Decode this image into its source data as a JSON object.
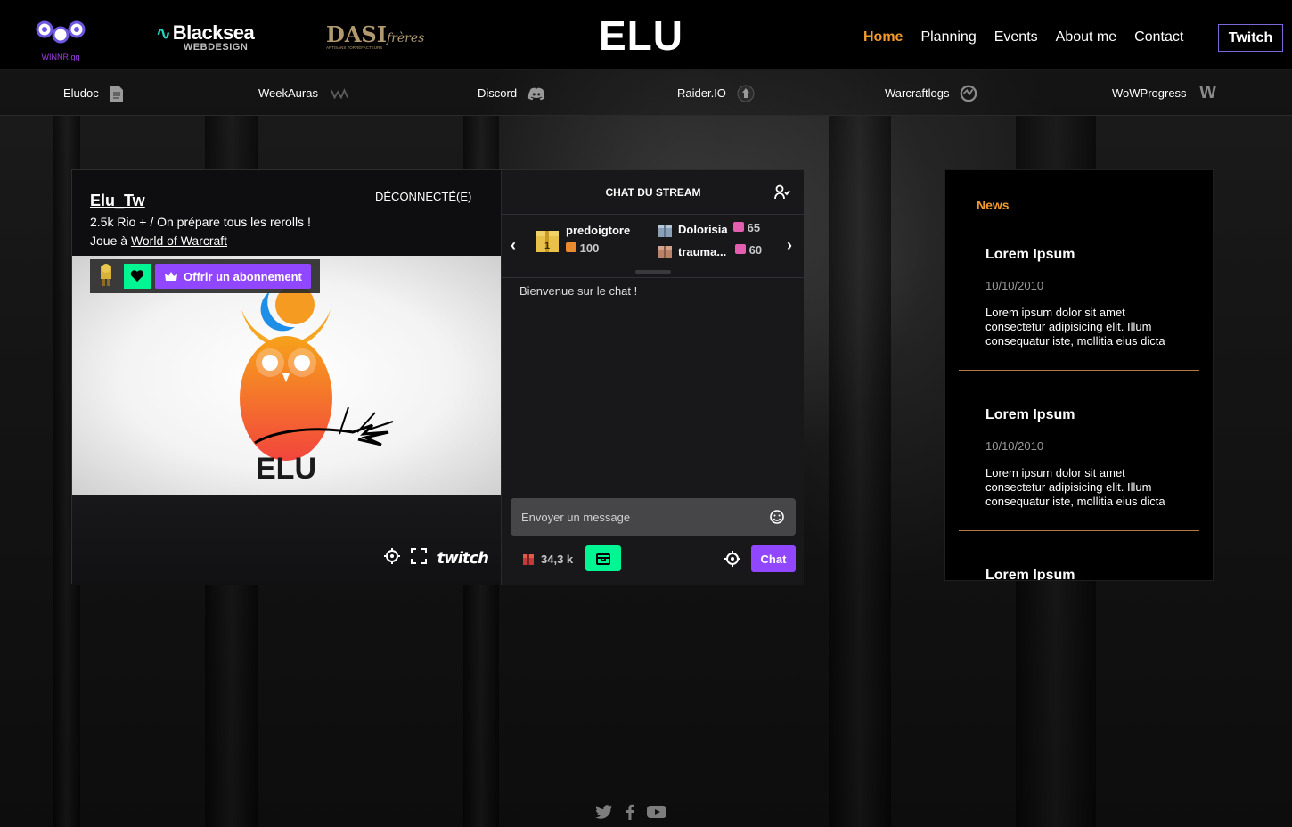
{
  "header": {
    "site_title": "ELU",
    "logos": {
      "winnr": "WINNR.gg",
      "blacksea_title": "Blacksea",
      "blacksea_sub": "WEBDESIGN",
      "dasi_title": "DASI",
      "dasi_script": "frères",
      "dasi_sub": "ARTISANS TORRÉFACTEURS"
    },
    "nav": [
      "Home",
      "Planning",
      "Events",
      "About me",
      "Contact"
    ],
    "nav_active": "Home",
    "twitch_button": "Twitch"
  },
  "subnav": [
    {
      "label": "Eludoc",
      "icon": "document-icon"
    },
    {
      "label": "WeekAuras",
      "icon": "weakauras-icon"
    },
    {
      "label": "Discord",
      "icon": "discord-icon"
    },
    {
      "label": "Raider.IO",
      "icon": "raiderio-icon"
    },
    {
      "label": "Warcraftlogs",
      "icon": "warcraftlogs-icon"
    },
    {
      "label": "WoWProgress",
      "icon": "wowprogress-icon"
    }
  ],
  "player": {
    "channel_name": "Elu_Tw",
    "stream_title": "2.5k Rio + / On prépare tous les rerolls !",
    "game_prefix": "Joue à",
    "game_name": "World of Warcraft",
    "status": "DÉCONNECTÉ(E)",
    "subscribe_label": "Offrir un abonnement",
    "watermark": "ELU",
    "brand": "twitch"
  },
  "chat": {
    "title": "CHAT DU STREAM",
    "leaderboard": [
      {
        "name": "predoigtore",
        "value": "100",
        "rank": "1"
      },
      {
        "name": "Dolorisia",
        "value": "65"
      },
      {
        "name": "trauma...",
        "value": "60"
      }
    ],
    "welcome": "Bienvenue sur le chat !",
    "input_placeholder": "Envoyer un message",
    "points": "34,3 k",
    "chat_button": "Chat"
  },
  "news": {
    "heading": "News",
    "items": [
      {
        "title": "Lorem Ipsum",
        "date": "10/10/2010",
        "body": "Lorem ipsum dolor sit amet consectetur adipisicing elit. Illum consequatur iste, mollitia eius dicta ducimus accusantium"
      },
      {
        "title": "Lorem Ipsum",
        "date": "10/10/2010",
        "body": "Lorem ipsum dolor sit amet consectetur adipisicing elit. Illum consequatur iste, mollitia eius dicta ducimus accusantium"
      },
      {
        "title": "Lorem Ipsum",
        "date": "",
        "body": ""
      }
    ]
  },
  "footer": {
    "social": [
      "twitter-icon",
      "facebook-icon",
      "youtube-icon"
    ]
  },
  "colors": {
    "accent_orange": "#f39a2d",
    "twitch_purple": "#9147ff",
    "twitch_green": "#00f593"
  }
}
